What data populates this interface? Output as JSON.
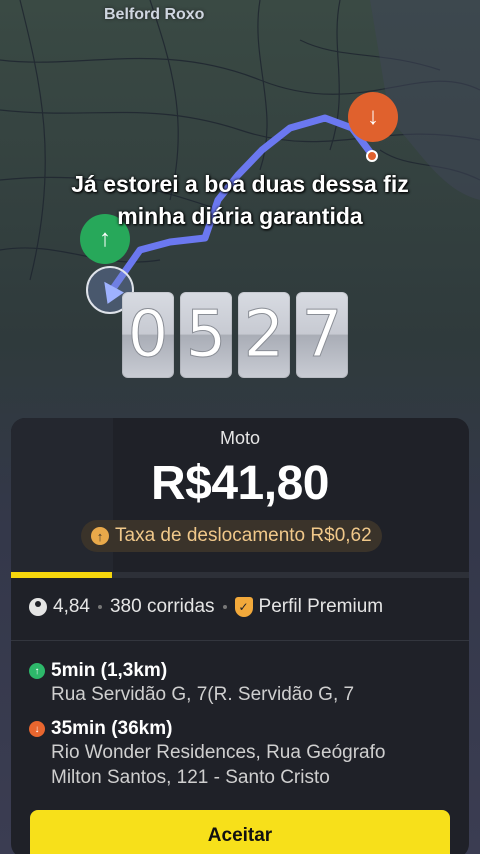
{
  "map": {
    "city_label": "Belford Roxo",
    "pickup_icon": "arrow-up-icon",
    "dropoff_icon": "arrow-down-icon"
  },
  "overlay": {
    "caption_line1": "Já estorei a boa duas dessa fiz",
    "caption_line2": "minha diária garantida",
    "timer_digits": [
      "0",
      "5",
      "2",
      "7"
    ]
  },
  "offer": {
    "vehicle": "Moto",
    "price": "R$41,80",
    "fee_label": "Taxa de deslocamento R$0,62",
    "timeout_progress_percent": 22
  },
  "driver_stats": {
    "rating": "4,84",
    "rides": "380 corridas",
    "profile": "Perfil Premium"
  },
  "pickup": {
    "eta": "5min (1,3km)",
    "address": "Rua Servidão G, 7(R. Servidão G, 7"
  },
  "dropoff": {
    "eta": "35min (36km)",
    "address_line1": "Rio Wonder Residences, Rua Geógrafo",
    "address_line2": "Milton Santos, 121 - Santo Cristo"
  },
  "actions": {
    "accept_label": "Aceitar"
  },
  "colors": {
    "accent_yellow": "#f7e01a",
    "pickup_green": "#27a85a",
    "dropoff_orange": "#e0612d",
    "route_blue": "#6b78f0"
  }
}
